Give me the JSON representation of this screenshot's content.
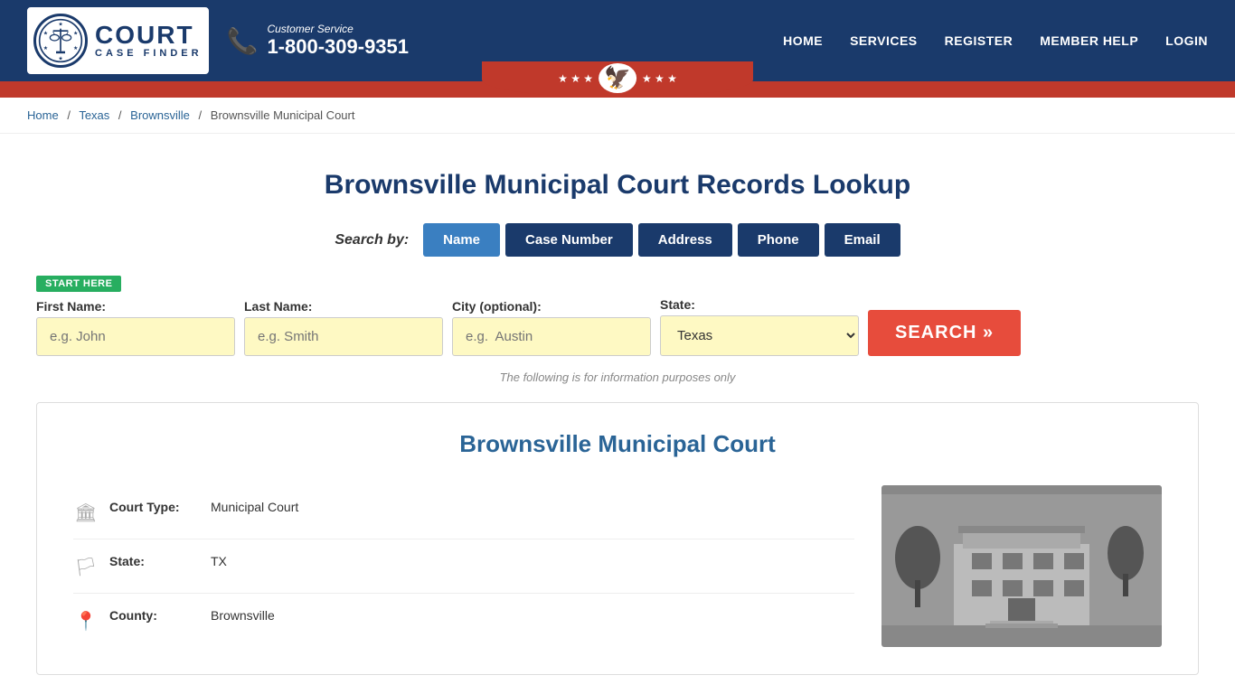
{
  "header": {
    "logo_court": "COURT",
    "logo_case_finder": "CASE FINDER",
    "customer_service_label": "Customer Service",
    "customer_service_phone": "1-800-309-9351",
    "nav": {
      "home": "HOME",
      "services": "SERVICES",
      "register": "REGISTER",
      "member_help": "MEMBER HELP",
      "login": "LOGIN"
    }
  },
  "breadcrumb": {
    "home": "Home",
    "texas": "Texas",
    "brownsville": "Brownsville",
    "current": "Brownsville Municipal Court"
  },
  "page": {
    "title": "Brownsville Municipal Court Records Lookup"
  },
  "search": {
    "by_label": "Search by:",
    "tabs": [
      {
        "label": "Name",
        "active": true
      },
      {
        "label": "Case Number",
        "active": false
      },
      {
        "label": "Address",
        "active": false
      },
      {
        "label": "Phone",
        "active": false
      },
      {
        "label": "Email",
        "active": false
      }
    ],
    "start_here_badge": "START HERE",
    "fields": {
      "first_name_label": "First Name:",
      "first_name_placeholder": "e.g. John",
      "last_name_label": "Last Name:",
      "last_name_placeholder": "e.g. Smith",
      "city_label": "City (optional):",
      "city_placeholder": "e.g.  Austin",
      "state_label": "State:",
      "state_value": "Texas"
    },
    "search_button": "SEARCH »",
    "info_note": "The following is for information purposes only"
  },
  "court_card": {
    "title": "Brownsville Municipal Court",
    "details": {
      "court_type_label": "Court Type:",
      "court_type_value": "Municipal Court",
      "state_label": "State:",
      "state_value": "TX",
      "county_label": "County:",
      "county_value": "Brownsville"
    }
  },
  "colors": {
    "primary_blue": "#1a3a6b",
    "accent_red": "#e74c3c",
    "link_blue": "#2a6496",
    "tab_active": "#3a7fc1",
    "input_bg": "#fef9c3",
    "green_badge": "#27ae60"
  }
}
